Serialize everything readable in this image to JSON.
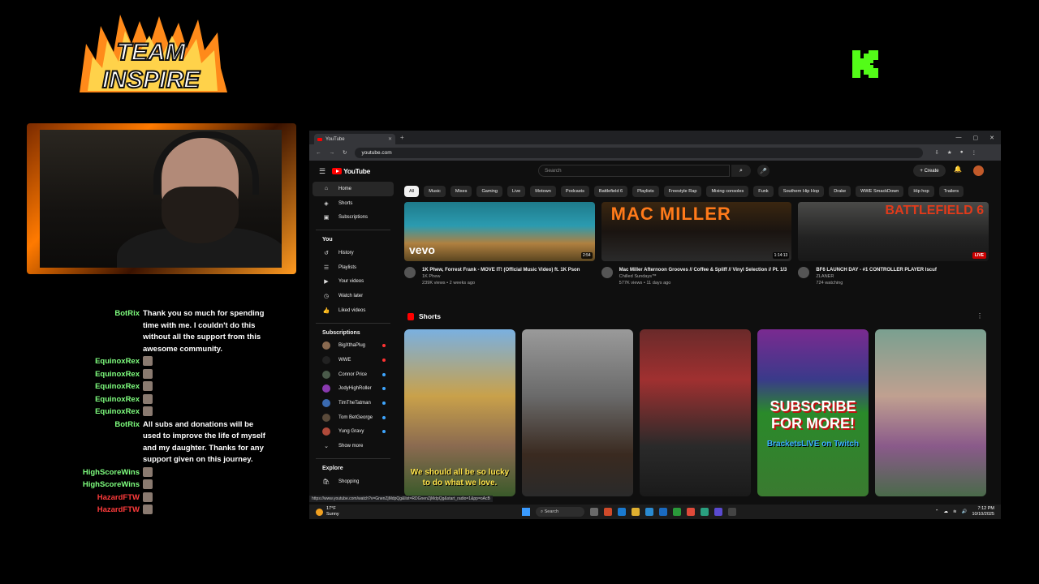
{
  "overlay": {
    "logo_text": "TEAM INSPIRE",
    "k_logo_text": "K",
    "colors": {
      "flame": "#ff8a1a",
      "kick_green": "#53fc18"
    }
  },
  "chat": [
    {
      "user": "BotRix",
      "color": "#7fff7f",
      "message": "Thank you so much for spending time with me. I couldn't do this without all the support from this awesome community.",
      "emote": false
    },
    {
      "user": "EquinoxRex",
      "color": "#7fff7f",
      "message": "",
      "emote": true
    },
    {
      "user": "EquinoxRex",
      "color": "#7fff7f",
      "message": "",
      "emote": true
    },
    {
      "user": "EquinoxRex",
      "color": "#7fff7f",
      "message": "",
      "emote": true
    },
    {
      "user": "EquinoxRex",
      "color": "#7fff7f",
      "message": "",
      "emote": true
    },
    {
      "user": "EquinoxRex",
      "color": "#7fff7f",
      "message": "",
      "emote": true
    },
    {
      "user": "BotRix",
      "color": "#7fff7f",
      "message": "All subs and donations will be used to improve the life of myself and my daughter. Thanks for any support given on this journey.",
      "emote": false
    },
    {
      "user": "HighScoreWins",
      "color": "#7fff7f",
      "message": "",
      "emote": true
    },
    {
      "user": "HighScoreWins",
      "color": "#7fff7f",
      "message": "",
      "emote": true
    },
    {
      "user": "HazardFTW",
      "color": "#ff3b3b",
      "message": "",
      "emote": true
    },
    {
      "user": "HazardFTW",
      "color": "#ff3b3b",
      "message": "",
      "emote": true
    }
  ],
  "browser": {
    "tab_title": "YouTube",
    "url": "youtube.com",
    "status_url": "https://www.youtube.com/watch?v=GnenZjMdpQg&list=RDGnenZjMdpQg&start_radio=1&pp=oAcB"
  },
  "youtube": {
    "logo": "YouTube",
    "search_placeholder": "Search",
    "create_label": "Create",
    "sidebar": {
      "main": [
        {
          "label": "Home",
          "icon": "⌂",
          "active": true
        },
        {
          "label": "Shorts",
          "icon": "◈",
          "active": false
        },
        {
          "label": "Subscriptions",
          "icon": "▣",
          "active": false
        }
      ],
      "you_header": "You",
      "you": [
        {
          "label": "History",
          "icon": "↺"
        },
        {
          "label": "Playlists",
          "icon": "☰"
        },
        {
          "label": "Your videos",
          "icon": "▶"
        },
        {
          "label": "Watch later",
          "icon": "◷"
        },
        {
          "label": "Liked videos",
          "icon": "👍"
        }
      ],
      "subs_header": "Subscriptions",
      "subs": [
        {
          "label": "BigXthaPlug",
          "color": "#8a6a50",
          "live": true
        },
        {
          "label": "WWE",
          "color": "#222",
          "live": true
        },
        {
          "label": "Connor Price",
          "color": "#4a5a4a",
          "live": false
        },
        {
          "label": "JodyHighRoller",
          "color": "#8a3ab0",
          "live": false
        },
        {
          "label": "TimTheTatman",
          "color": "#3a6ab0",
          "live": false
        },
        {
          "label": "Tom BetGeorge",
          "color": "#5a4a3a",
          "live": false
        },
        {
          "label": "Yung Gravy",
          "color": "#b04a3a",
          "live": false
        }
      ],
      "show_more": "Show more",
      "explore_header": "Explore",
      "explore": [
        {
          "label": "Shopping",
          "icon": "🛍"
        }
      ]
    },
    "chips": [
      "All",
      "Music",
      "Mixes",
      "Gaming",
      "Live",
      "Motown",
      "Podcasts",
      "Battlefield 6",
      "Playlists",
      "Freestyle Rap",
      "Mixing consoles",
      "Funk",
      "Southern Hip Hop",
      "Drake",
      "WWE SmackDown",
      "Hip hop",
      "Trailers"
    ],
    "videos": [
      {
        "title": "1K Phew, Forrest Frank - MOVE IT! (Official Music Video) ft. 1K Pson",
        "channel": "1K Phew",
        "stats": "239K views • 2 weeks ago",
        "duration": "2:54",
        "thumb_text": "vevo",
        "live": false
      },
      {
        "title": "Mac Miller Afternoon Grooves // Coffee & Spliff // Vinyl Selection // Pt. 1/3",
        "channel": "Chilled Sundays™",
        "stats": "577K views • 11 days ago",
        "duration": "1:14:13",
        "thumb_text": "MAC MILLER",
        "live": false
      },
      {
        "title": "BF6 LAUNCH DAY - #1 CONTROLLER PLAYER Iscuf",
        "channel": "ZLANER",
        "stats": "724 watching",
        "duration": "",
        "thumb_text": "BATTLEFIELD 6",
        "live": true,
        "live_label": "LIVE"
      }
    ],
    "shorts_title": "Shorts",
    "shorts": [
      {
        "caption": "We should all be so lucky to do what we love."
      },
      {
        "caption": ""
      },
      {
        "caption": ""
      },
      {
        "caption": "SUBSCRIBE FOR MORE!",
        "subcaption": "BracketsLIVE on Twitch"
      },
      {
        "caption": ""
      }
    ]
  },
  "taskbar": {
    "temp": "17°F",
    "weather": "Sunny",
    "search": "Search",
    "time": "7:12 PM",
    "date": "10/10/2025"
  }
}
